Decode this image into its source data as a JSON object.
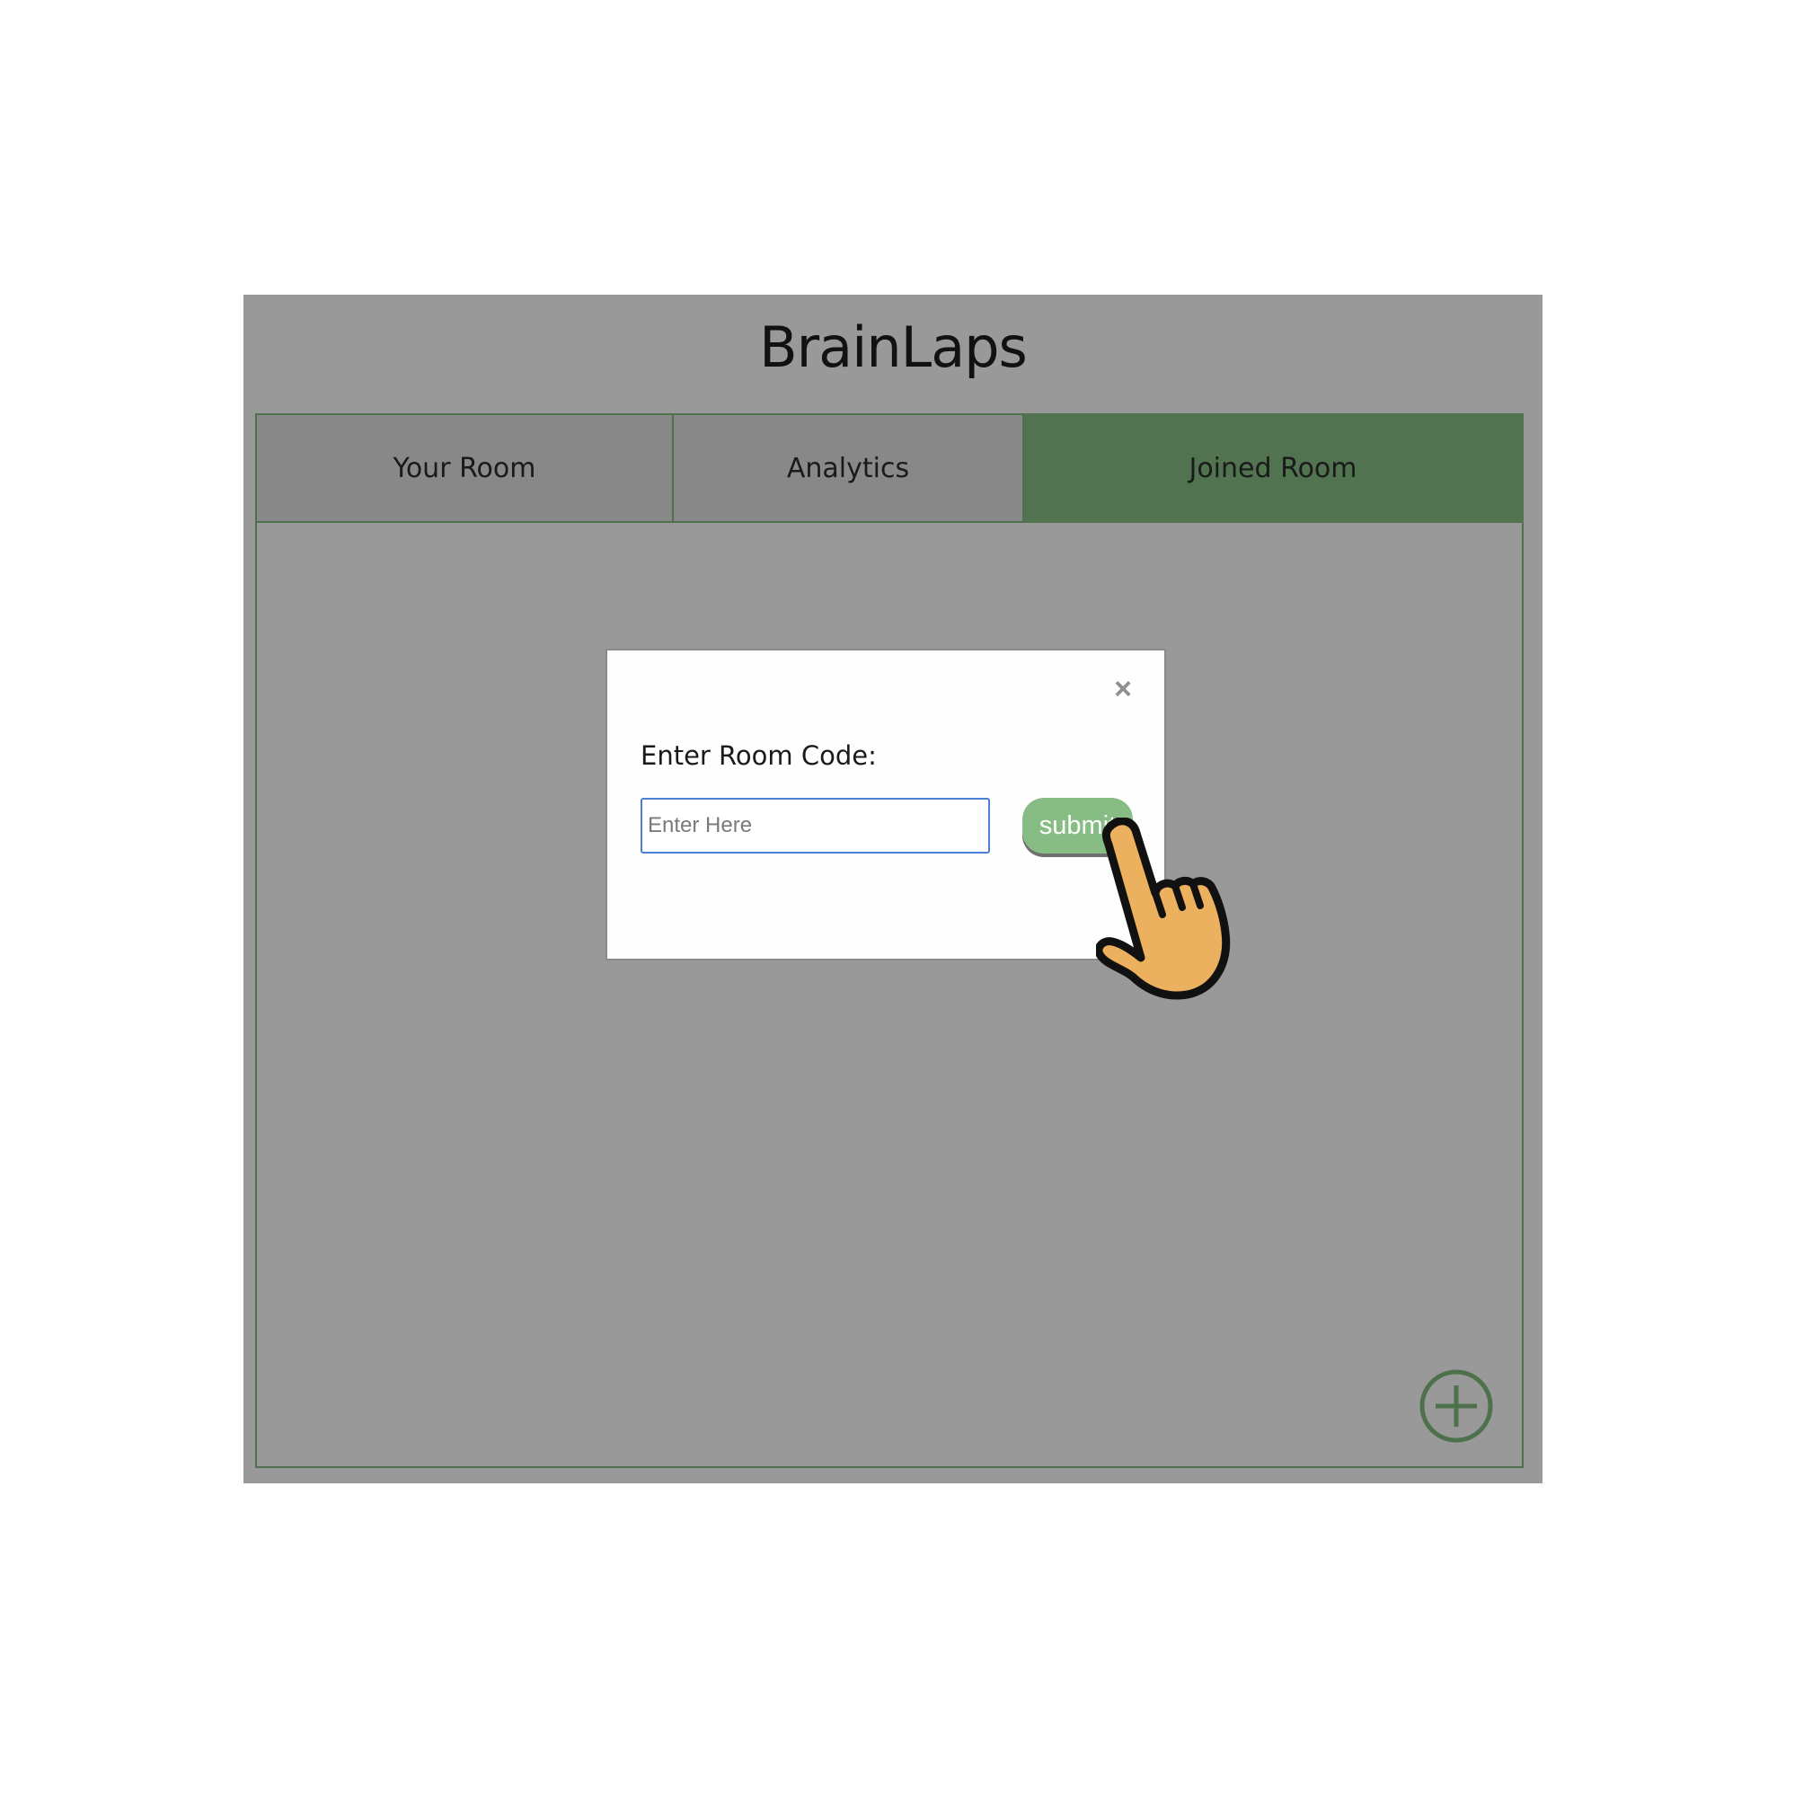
{
  "app": {
    "title": "BrainLaps"
  },
  "tabs": [
    {
      "label": "Your Room",
      "active": false
    },
    {
      "label": "Analytics",
      "active": false
    },
    {
      "label": "Joined Room",
      "active": true
    }
  ],
  "modal": {
    "prompt": "Enter Room Code:",
    "input_placeholder": "Enter Here",
    "input_value": "",
    "submit_label": "submit",
    "close_symbol": "×"
  },
  "icons": {
    "close": "close-icon",
    "add": "plus-circle-icon",
    "pointer": "hand-pointer-icon"
  },
  "colors": {
    "app_background": "#999999",
    "tab_inactive": "#888888",
    "tab_active": "#52734f",
    "border_green": "#507050",
    "submit_green": "#87bd84",
    "input_focus": "#4a7fd6"
  }
}
